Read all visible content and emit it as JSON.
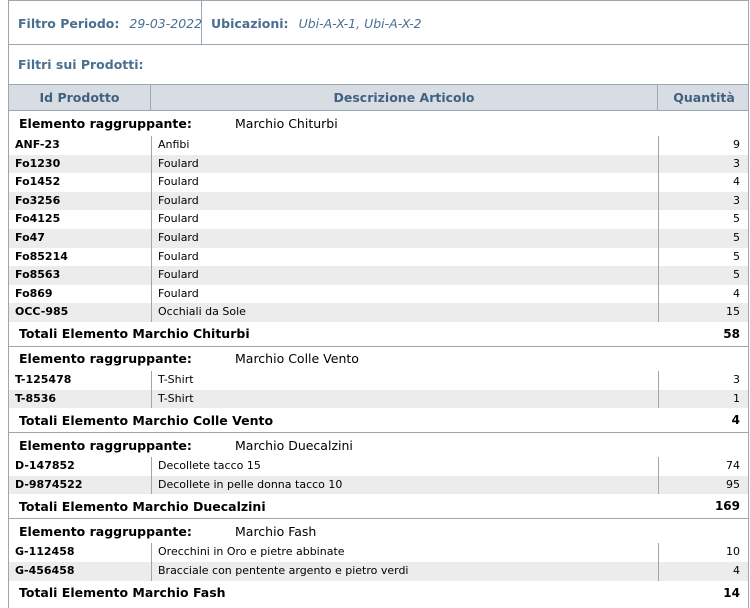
{
  "filters": {
    "periodo_label": "Filtro Periodo:",
    "periodo_value": "29-03-2022",
    "ubicazioni_label": "Ubicazioni:",
    "ubicazioni_value": "Ubi-A-X-1, Ubi-A-X-2",
    "prodotti_label": "Filtri sui Prodotti:"
  },
  "table": {
    "headers": [
      "Id Prodotto",
      "Descrizione Articolo",
      "Quantità"
    ]
  },
  "group_label": "Elemento raggruppante:",
  "groups": [
    {
      "name": "Marchio Chiturbi",
      "rows": [
        {
          "id": "ANF-23",
          "desc": "Anfibi",
          "qty": "9"
        },
        {
          "id": "Fo1230",
          "desc": "Foulard",
          "qty": "3"
        },
        {
          "id": "Fo1452",
          "desc": "Foulard",
          "qty": "4"
        },
        {
          "id": "Fo3256",
          "desc": "Foulard",
          "qty": "3"
        },
        {
          "id": "Fo4125",
          "desc": "Foulard",
          "qty": "5"
        },
        {
          "id": "Fo47",
          "desc": "Foulard",
          "qty": "5"
        },
        {
          "id": "Fo85214",
          "desc": "Foulard",
          "qty": "5"
        },
        {
          "id": "Fo8563",
          "desc": "Foulard",
          "qty": "5"
        },
        {
          "id": "Fo869",
          "desc": "Foulard",
          "qty": "4"
        },
        {
          "id": "OCC-985",
          "desc": "Occhiali da Sole",
          "qty": "15"
        }
      ],
      "total_label": "Totali Elemento Marchio Chiturbi",
      "total": "58"
    },
    {
      "name": "Marchio Colle Vento",
      "rows": [
        {
          "id": "T-125478",
          "desc": "T-Shirt",
          "qty": "3"
        },
        {
          "id": "T-8536",
          "desc": "T-Shirt",
          "qty": "1"
        }
      ],
      "total_label": "Totali Elemento Marchio Colle Vento",
      "total": "4"
    },
    {
      "name": "Marchio Duecalzini",
      "rows": [
        {
          "id": "D-147852",
          "desc": "Decollete tacco 15",
          "qty": "74"
        },
        {
          "id": "D-9874522",
          "desc": "Decollete in pelle donna tacco 10",
          "qty": "95"
        }
      ],
      "total_label": "Totali Elemento Marchio Duecalzini",
      "total": "169"
    },
    {
      "name": "Marchio Fash",
      "rows": [
        {
          "id": "G-112458",
          "desc": "Orecchini in Oro e pietre abbinate",
          "qty": "10"
        },
        {
          "id": "G-456458",
          "desc": "Bracciale con pentente argento e pietro verdi",
          "qty": "4"
        }
      ],
      "total_label": "Totali Elemento Marchio Fash",
      "total": "14"
    }
  ]
}
